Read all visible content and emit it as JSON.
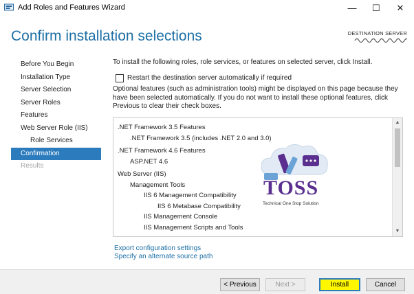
{
  "window": {
    "title": "Add Roles and Features Wizard",
    "controls": {
      "minimize": "—",
      "maximize": "☐",
      "close": "✕"
    }
  },
  "header": {
    "page_title": "Confirm installation selections",
    "destination_label": "DESTINATION SERVER",
    "destination_server": "(redacted)"
  },
  "sidebar": {
    "items": [
      {
        "label": "Before You Begin",
        "state": "normal"
      },
      {
        "label": "Installation Type",
        "state": "normal"
      },
      {
        "label": "Server Selection",
        "state": "normal"
      },
      {
        "label": "Server Roles",
        "state": "normal"
      },
      {
        "label": "Features",
        "state": "normal"
      },
      {
        "label": "Web Server Role (IIS)",
        "state": "normal"
      },
      {
        "label": "Role Services",
        "state": "sub"
      },
      {
        "label": "Confirmation",
        "state": "active"
      },
      {
        "label": "Results",
        "state": "disabled"
      }
    ]
  },
  "main": {
    "intro": "To install the following roles, role services, or features on selected server, click Install.",
    "restart_label": "Restart the destination server automatically if required",
    "restart_checked": false,
    "optional_text": "Optional features (such as administration tools) might be displayed on this page because they have been selected automatically. If you do not want to install these optional features, click Previous to clear their check boxes.",
    "features": [
      {
        "label": ".NET Framework 3.5 Features",
        "level": 1
      },
      {
        "label": ".NET Framework 3.5 (includes .NET 2.0 and 3.0)",
        "level": 2
      },
      {
        "label": ".NET Framework 4.6 Features",
        "level": 1
      },
      {
        "label": "ASP.NET 4.6",
        "level": 2
      },
      {
        "label": "Web Server (IIS)",
        "level": 1
      },
      {
        "label": "Management Tools",
        "level": 2
      },
      {
        "label": "IIS 6 Management Compatibility",
        "level": 3
      },
      {
        "label": "IIS 6 Metabase Compatibility",
        "level": 4
      },
      {
        "label": "IIS Management Console",
        "level": 3
      },
      {
        "label": "IIS Management Scripts and Tools",
        "level": 3
      }
    ],
    "links": {
      "export": "Export configuration settings",
      "alternate_source": "Specify an alternate source path"
    }
  },
  "watermark": {
    "text": "TOSS",
    "tagline": "Technical One Stop Solution"
  },
  "footer": {
    "previous": "< Previous",
    "next": "Next >",
    "install": "Install",
    "cancel": "Cancel"
  },
  "colors": {
    "accent": "#1d6fa5",
    "nav_active_bg": "#2b7bbd",
    "install_highlight": "#fff700",
    "watermark_purple": "#5a2f8f"
  }
}
